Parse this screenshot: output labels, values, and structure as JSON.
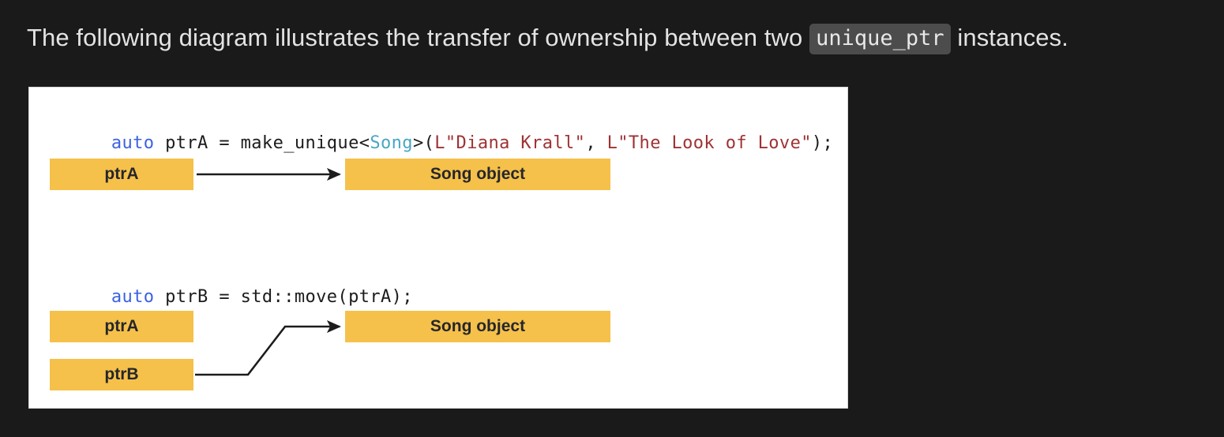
{
  "intro": {
    "before": "The following diagram illustrates the transfer of ownership between two ",
    "code": "unique_ptr",
    "after": " instances."
  },
  "figure": {
    "background_color": "#ffffff",
    "border_color": "#d9d9d9",
    "node_color": "#f5c14a",
    "node_text_color": "#26262b",
    "arrow_color": "#1c1c1c",
    "code_line_1": {
      "tokens": [
        {
          "text": "auto",
          "kind": "keyword"
        },
        {
          "text": " ptrA = make_unique<",
          "kind": "plain"
        },
        {
          "text": "Song",
          "kind": "type"
        },
        {
          "text": ">(",
          "kind": "plain"
        },
        {
          "text": "L\"Diana Krall\"",
          "kind": "string"
        },
        {
          "text": ", ",
          "kind": "plain"
        },
        {
          "text": "L\"The Look of Love\"",
          "kind": "string"
        },
        {
          "text": ");",
          "kind": "plain"
        }
      ]
    },
    "code_line_2": {
      "tokens": [
        {
          "text": "auto",
          "kind": "keyword"
        },
        {
          "text": " ptrB = std::move(ptrA);",
          "kind": "plain"
        }
      ]
    },
    "nodes": {
      "stage1_pointer": "ptrA",
      "stage1_object": "Song object",
      "stage2_pointer_a": "ptrA",
      "stage2_pointer_b": "ptrB",
      "stage2_object": "Song object"
    }
  },
  "colors": {
    "page_background": "#1a1a1a",
    "intro_text": "#e3e3e3",
    "inline_code_background": "#4c4c4c",
    "keyword": "#3b62e0",
    "type": "#4aa6c4",
    "string": "#9e3233"
  }
}
